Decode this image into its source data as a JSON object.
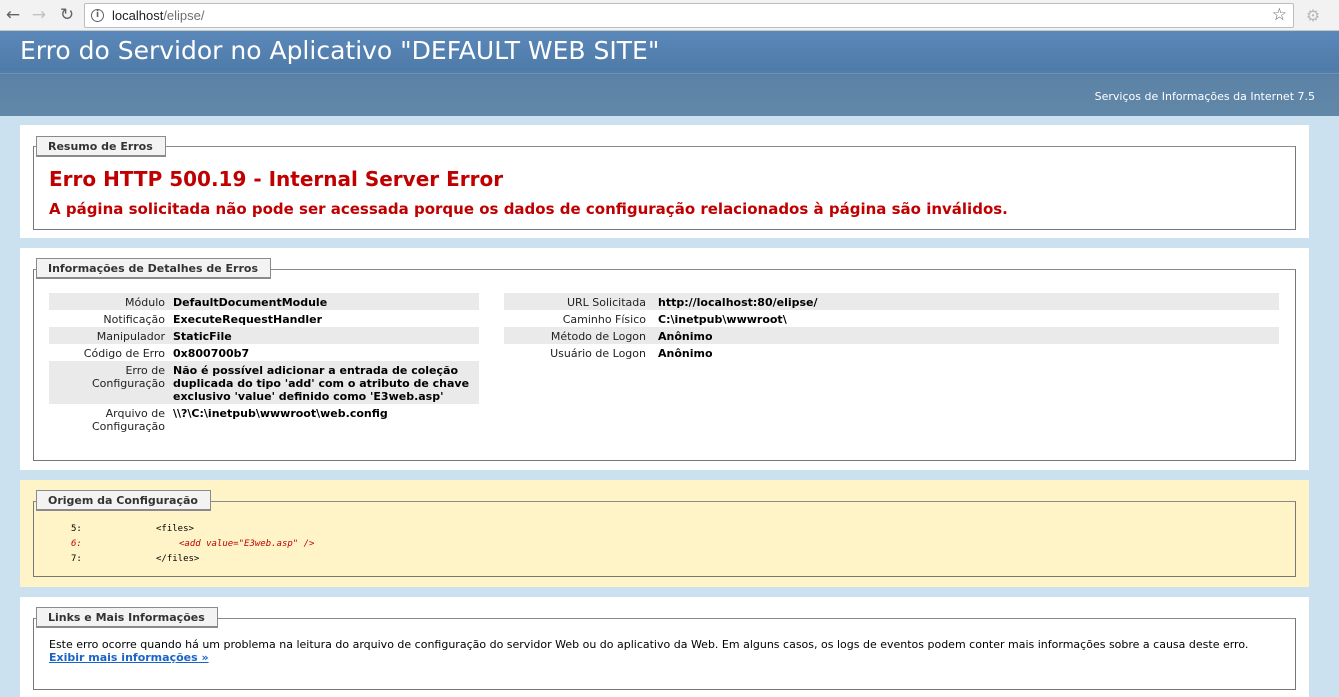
{
  "browser": {
    "url_host": "localhost",
    "url_path": "/elipse/"
  },
  "header": {
    "title": "Erro do Servidor no Aplicativo \"DEFAULT WEB SITE\"",
    "subtitle": "Serviços de Informações da Internet 7.5"
  },
  "summary": {
    "legend": "Resumo de Erros",
    "error_title": "Erro HTTP 500.19 - Internal Server Error",
    "error_message": "A página solicitada não pode ser acessada porque os dados de configuração relacionados à página são inválidos."
  },
  "details": {
    "legend": "Informações de Detalhes de Erros",
    "left": [
      {
        "label": "Módulo",
        "value": "DefaultDocumentModule"
      },
      {
        "label": "Notificação",
        "value": "ExecuteRequestHandler"
      },
      {
        "label": "Manipulador",
        "value": "StaticFile"
      },
      {
        "label": "Código de Erro",
        "value": "0x800700b7"
      },
      {
        "label": "Erro de Configuração",
        "value": "Não é possível adicionar a entrada de coleção duplicada do tipo 'add' com o atributo de chave exclusivo 'value' definido como 'E3web.asp'"
      },
      {
        "label": "Arquivo de Configuração",
        "value": "\\\\?\\C:\\inetpub\\wwwroot\\web.config"
      }
    ],
    "right": [
      {
        "label": "URL Solicitada",
        "value": "http://localhost:80/elipse/"
      },
      {
        "label": "Caminho Físico",
        "value": "C:\\inetpub\\wwwroot\\"
      },
      {
        "label": "Método de Logon",
        "value": "Anônimo"
      },
      {
        "label": "Usuário de Logon",
        "value": "Anônimo"
      }
    ]
  },
  "config_source": {
    "legend": "Origem da Configuração",
    "lines": [
      {
        "num": "5:",
        "code": "<files>"
      },
      {
        "num": "6:",
        "code": "<add value=\"E3web.asp\" />"
      },
      {
        "num": "7:",
        "code": "</files>"
      }
    ]
  },
  "links": {
    "legend": "Links e Mais Informações",
    "text": "Este erro ocorre quando há um problema na leitura do arquivo de configuração do servidor Web ou do aplicativo da Web. Em alguns casos, os logs de eventos podem conter mais informações sobre a causa deste erro.",
    "more_link": "Exibir mais informações »"
  },
  "colors": {
    "header_bg": "#5a88ba",
    "error_red": "#c00000",
    "page_bg": "#cbe1ef",
    "config_bg": "#fff4c8",
    "link": "#1a63c9"
  }
}
